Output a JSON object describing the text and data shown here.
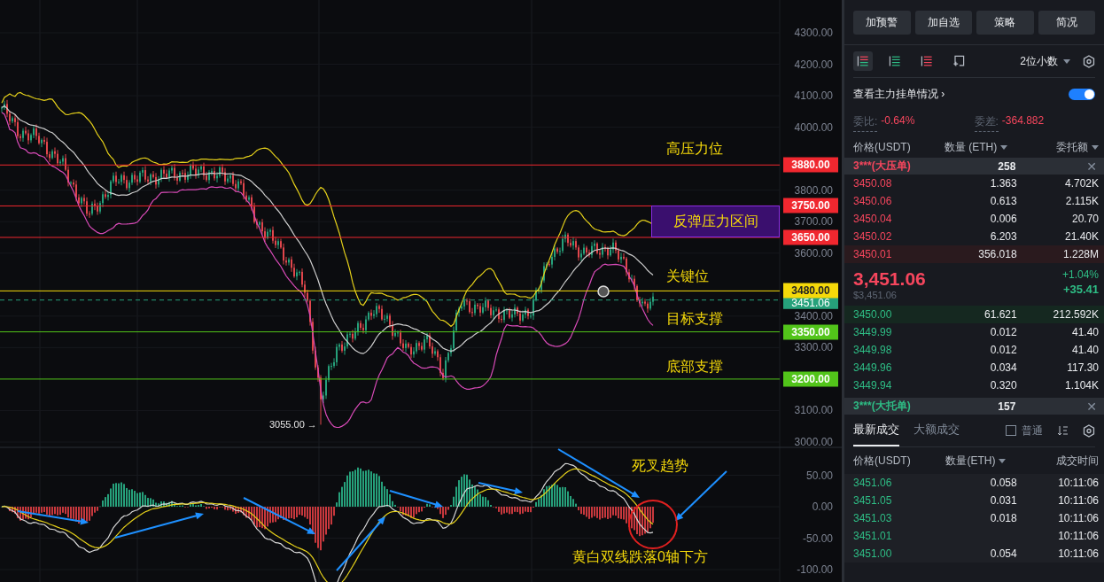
{
  "chart": {
    "price_axis": [
      "4300.00",
      "4200.00",
      "4100.00",
      "4000.00",
      "3800.00",
      "3700.00",
      "3600.00",
      "3400.00",
      "3300.00",
      "3100.00",
      "3000.00"
    ],
    "current_price": "3451.06",
    "levels": [
      {
        "label": "3880.00",
        "color": "#f0272f"
      },
      {
        "label": "3750.00",
        "color": "#f0272f"
      },
      {
        "label": "3650.00",
        "color": "#f0272f"
      },
      {
        "label": "3480.00",
        "color": "#f5d90a"
      },
      {
        "label": "3350.00",
        "color": "#52c41a"
      },
      {
        "label": "3200.00",
        "color": "#52c41a"
      }
    ],
    "resistance_zone": "反弹压力区间",
    "annotations": [
      "高压力位",
      "关键位",
      "目标支撑",
      "底部支撑"
    ],
    "low_marker": "3055.00 →",
    "macd_axis": [
      "50.00",
      "0.00",
      "-50.00",
      "-100.00"
    ],
    "macd_notes": [
      "死叉趋势",
      "黄白双线跌落0轴下方"
    ]
  },
  "side": {
    "actions": [
      "加预警",
      "加自选",
      "策略",
      "简况"
    ],
    "views": [
      {
        "kind": "both",
        "selected": true
      },
      {
        "kind": "bids",
        "selected": false
      },
      {
        "kind": "asks",
        "selected": false
      },
      {
        "kind": "custom",
        "selected": false
      }
    ],
    "precision": "2位小数",
    "main_orders": {
      "label": "查看主力挂单情况",
      "chevron": "›",
      "on": true
    },
    "stats": [
      {
        "label": "委比:",
        "value": "-0.64%"
      },
      {
        "label": "委差:",
        "value": "-364.882"
      }
    ],
    "book_columns": [
      {
        "label": "价格(USDT)",
        "dropdown": false
      },
      {
        "label": "数量 (ETH)",
        "dropdown": true
      },
      {
        "label": "委托额",
        "dropdown": true
      }
    ],
    "big_ask": {
      "label": "3***(大压单)",
      "qty": "258",
      "close": "✕"
    },
    "asks": [
      {
        "price": "3450.08",
        "qty": "1.363",
        "total": "4.702K",
        "highlighted": false
      },
      {
        "price": "3450.06",
        "qty": "0.613",
        "total": "2.115K",
        "highlighted": false
      },
      {
        "price": "3450.04",
        "qty": "0.006",
        "total": "20.70",
        "highlighted": false
      },
      {
        "price": "3450.02",
        "qty": "6.203",
        "total": "21.40K",
        "highlighted": false
      },
      {
        "price": "3450.01",
        "qty": "356.018",
        "total": "1.228M",
        "highlighted": true
      }
    ],
    "last": {
      "price": "3,451.06",
      "usd": "$3,451.06",
      "change_pct": "+1.04%",
      "change": "+35.41"
    },
    "bids": [
      {
        "price": "3450.00",
        "qty": "61.621",
        "total": "212.592K",
        "highlighted": true
      },
      {
        "price": "3449.99",
        "qty": "0.012",
        "total": "41.40",
        "highlighted": false
      },
      {
        "price": "3449.98",
        "qty": "0.012",
        "total": "41.40",
        "highlighted": false
      },
      {
        "price": "3449.96",
        "qty": "0.034",
        "total": "117.30",
        "highlighted": false
      },
      {
        "price": "3449.94",
        "qty": "0.320",
        "total": "1.104K",
        "highlighted": false
      }
    ],
    "big_bid": {
      "label": "3***(大托单)",
      "qty": "157",
      "close": "✕"
    },
    "trade_tabs": [
      {
        "label": "最新成交",
        "selected": true
      },
      {
        "label": "大额成交",
        "selected": false
      }
    ],
    "normal_filter": {
      "label": "普通",
      "checked": false
    },
    "trade_columns": [
      {
        "label": "价格(USDT)",
        "dropdown": false
      },
      {
        "label": "数量(ETH)",
        "dropdown": true
      },
      {
        "label": "成交时间",
        "dropdown": false
      }
    ],
    "trades": [
      {
        "price": "3451.06",
        "qty": "0.058",
        "time": "10:11:06"
      },
      {
        "price": "3451.05",
        "qty": "0.031",
        "time": "10:11:06"
      },
      {
        "price": "3451.03",
        "qty": "0.018",
        "time": "10:11:06"
      },
      {
        "price": "3451.01",
        "time": "10:11:06"
      },
      {
        "price": "3451.00",
        "qty": "0.054",
        "time": "10:11:06"
      }
    ]
  }
}
